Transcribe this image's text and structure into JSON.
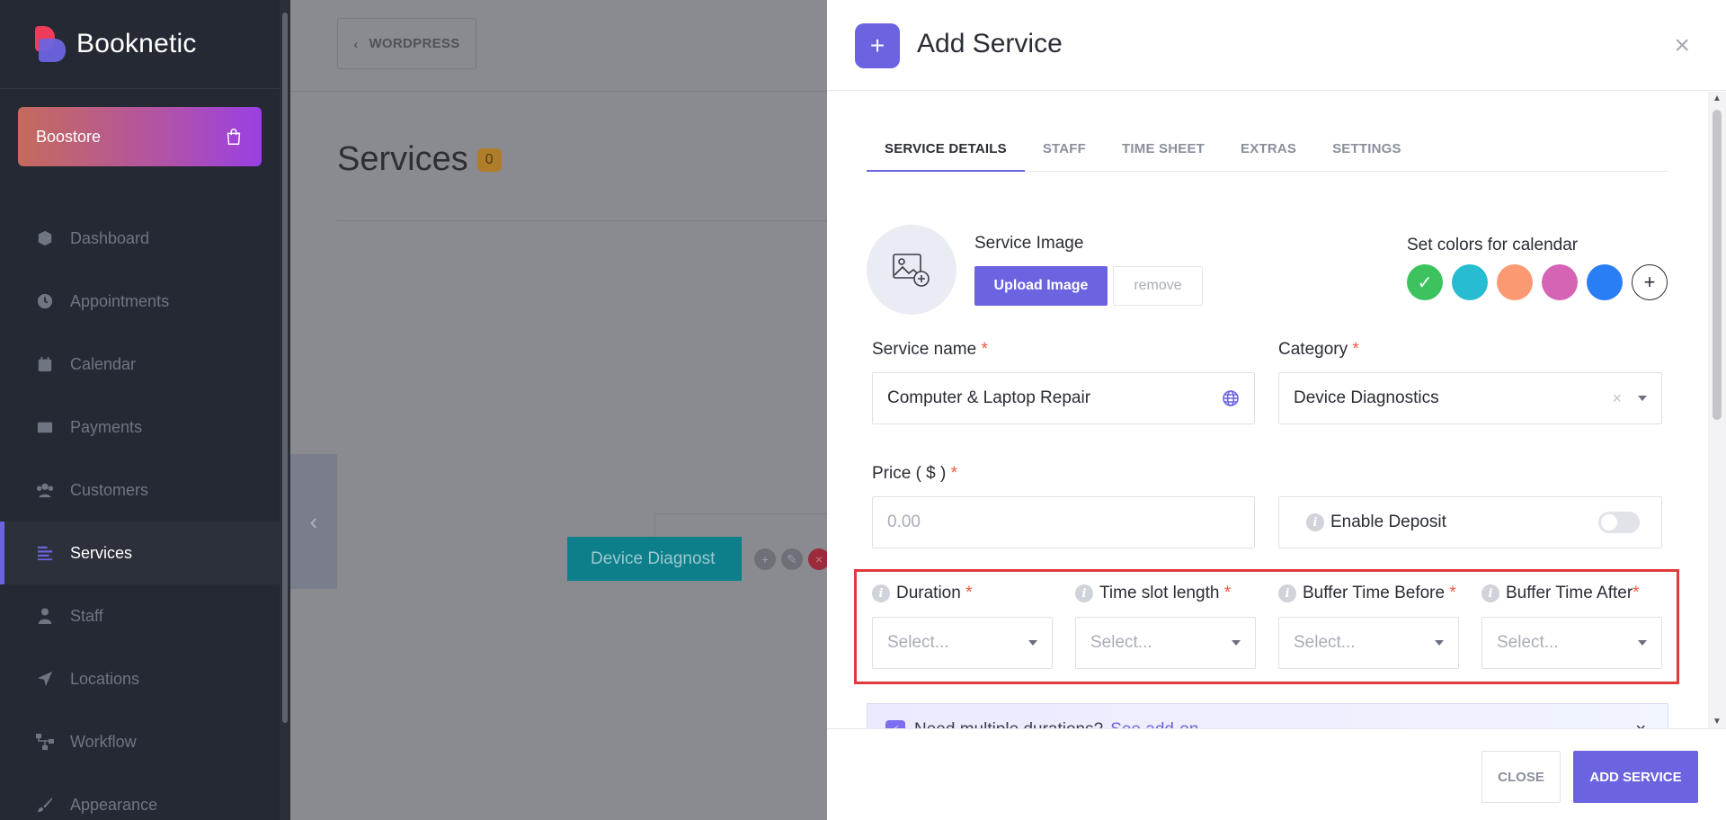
{
  "sidebar": {
    "brand": "Booknetic",
    "boostore": "Boostore",
    "items": [
      {
        "label": "Dashboard",
        "icon": "cube-icon"
      },
      {
        "label": "Appointments",
        "icon": "clock-icon"
      },
      {
        "label": "Calendar",
        "icon": "calendar-icon"
      },
      {
        "label": "Payments",
        "icon": "wallet-icon"
      },
      {
        "label": "Customers",
        "icon": "users-icon"
      },
      {
        "label": "Services",
        "icon": "list-icon",
        "active": true
      },
      {
        "label": "Staff",
        "icon": "user-icon"
      },
      {
        "label": "Locations",
        "icon": "location-arrow-icon"
      },
      {
        "label": "Workflow",
        "icon": "workflow-icon"
      },
      {
        "label": "Appearance",
        "icon": "brush-icon"
      }
    ]
  },
  "main": {
    "back_button": "WORDPRESS",
    "title": "Services",
    "count": "0",
    "card_label": "Device Diagnost"
  },
  "modal": {
    "title": "Add Service",
    "tabs": [
      "SERVICE DETAILS",
      "STAFF",
      "TIME SHEET",
      "EXTRAS",
      "SETTINGS"
    ],
    "service_image_label": "Service Image",
    "upload_label": "Upload Image",
    "remove_label": "remove",
    "colors_label": "Set colors for calendar",
    "colors": [
      "#3cc35e",
      "#27bcd1",
      "#fb9a72",
      "#d564b5",
      "#2a7ef5"
    ],
    "service_name": {
      "label": "Service name",
      "required": "*",
      "value": "Computer & Laptop Repair"
    },
    "category": {
      "label": "Category",
      "required": "*",
      "value": "Device Diagnostics"
    },
    "price": {
      "label": "Price ( $ )",
      "required": "*",
      "placeholder": "0.00"
    },
    "deposit": {
      "label": "Enable Deposit",
      "enabled": false
    },
    "time_fields": [
      {
        "label": "Duration",
        "required": "*",
        "placeholder": "Select..."
      },
      {
        "label": "Time slot length",
        "required": "*",
        "placeholder": "Select..."
      },
      {
        "label": "Buffer Time Before",
        "required": "*",
        "placeholder": "Select..."
      },
      {
        "label": "Buffer Time After",
        "required": "*",
        "placeholder": "Select..."
      }
    ],
    "banner": {
      "text": "Need multiple durations?",
      "link": "See add-on"
    },
    "footer": {
      "close": "CLOSE",
      "add": "ADD SERVICE"
    }
  },
  "colors": {
    "accent": "#6c63e0",
    "highlight": "#e03a3a",
    "sidebar_bg": "#252933"
  }
}
